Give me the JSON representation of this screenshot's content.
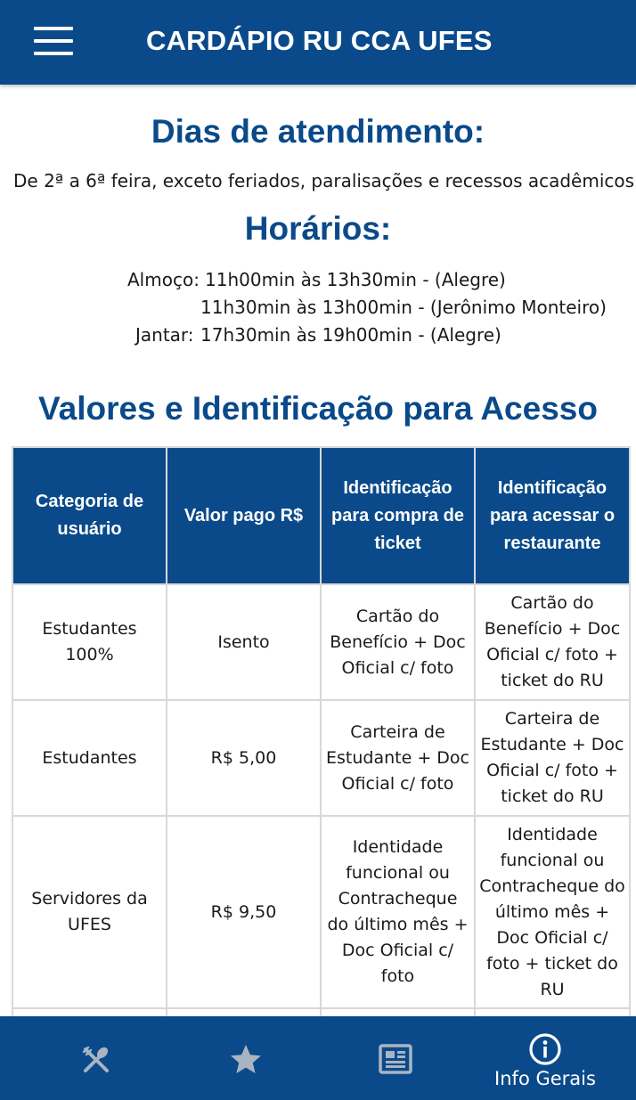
{
  "header": {
    "title": "CARDÁPIO RU CCA UFES",
    "menu_icon": "hamburger-menu-icon"
  },
  "service_days": {
    "heading": "Dias de atendimento:",
    "text": "De 2ª a 6ª feira, exceto feriados, paralisações e recessos acadêmicos."
  },
  "hours": {
    "heading": "Horários:",
    "lunch_label": "Almoço:",
    "lunch_line_1": "11h00min às 13h30min - (Alegre)",
    "lunch_line_2": "11h30min às 13h00min - (Jerônimo Monteiro)",
    "dinner_label": "Jantar:",
    "dinner_line": "17h30min às 19h00min - (Alegre)"
  },
  "access": {
    "heading": "Valores e Identificação para Acesso",
    "columns": [
      "Categoria de usuário",
      "Valor pago R$",
      "Identificação para compra de ticket",
      "Identificação para acessar o restaurante"
    ],
    "rows": [
      [
        "Estudantes 100%",
        "Isento",
        "Cartão do Benefício + Doc Oficial c/ foto",
        "Cartão do Benefício + Doc Oficial c/ foto + ticket do RU"
      ],
      [
        "Estudantes",
        "R$ 5,00",
        "Carteira de Estudante + Doc Oficial c/ foto",
        "Carteira de Estudante + Doc Oficial c/ foto + ticket do RU"
      ],
      [
        "Servidores da UFES",
        "R$ 9,50",
        "Identidade funcional ou Contracheque do último mês + Doc Oficial c/ foto",
        "Identidade funcional ou Contracheque do último mês + Doc Oficial c/ foto + ticket do RU"
      ],
      [
        "",
        "",
        "",
        ""
      ]
    ]
  },
  "bottom_nav": {
    "items": [
      {
        "icon": "fork-knife-icon",
        "label": ""
      },
      {
        "icon": "star-icon",
        "label": ""
      },
      {
        "icon": "newspaper-icon",
        "label": ""
      },
      {
        "icon": "info-icon",
        "label": "Info Gerais"
      }
    ],
    "active_color": "#ffffff",
    "inactive_color": "#a9b4c2"
  },
  "colors": {
    "brand": "#0a4a8a",
    "table_border": "#d8d8d8"
  }
}
